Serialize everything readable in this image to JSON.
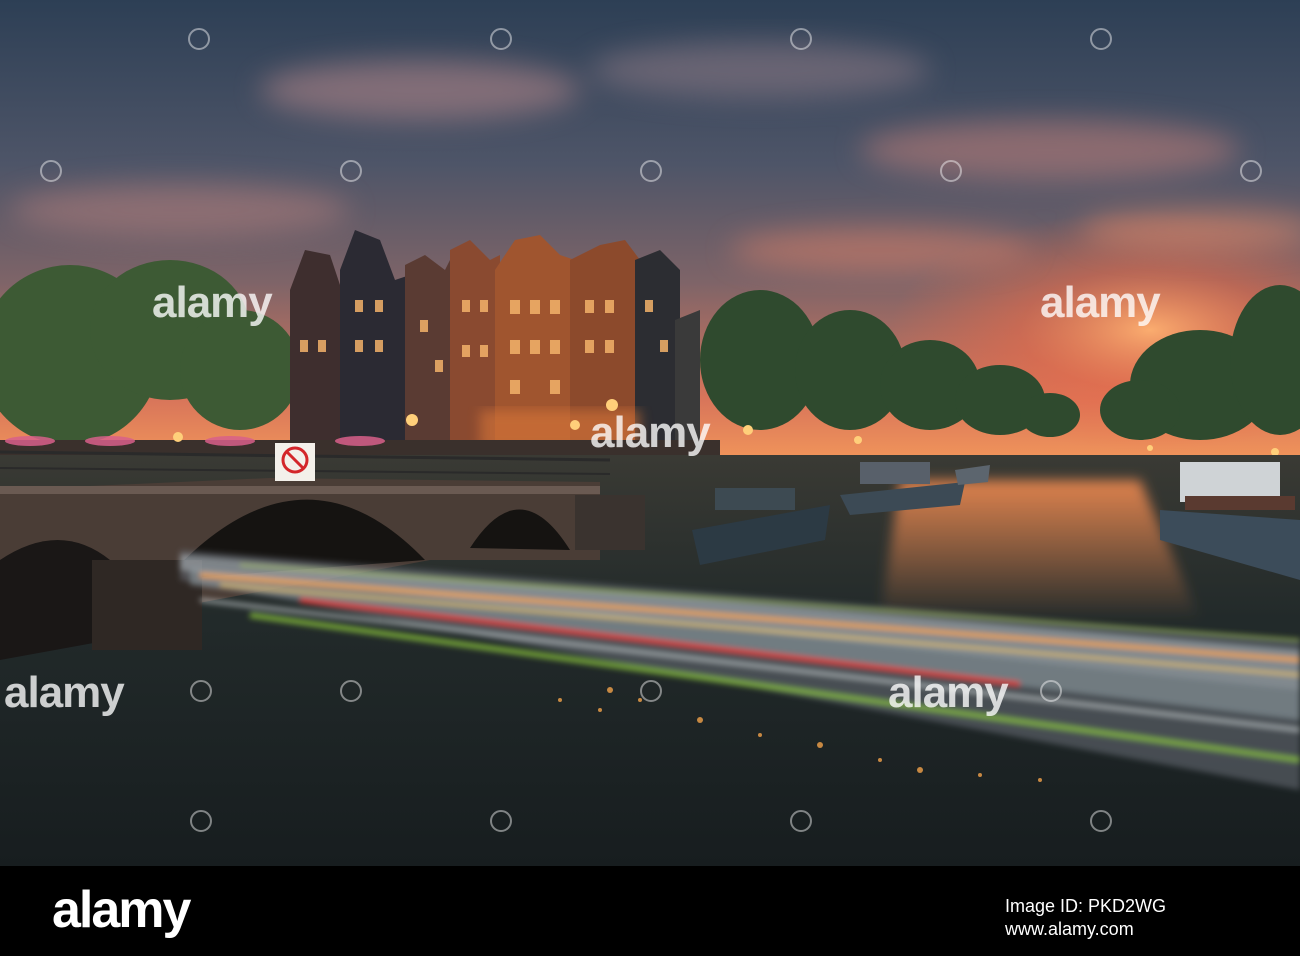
{
  "watermark": {
    "brand": "alamy"
  },
  "footer": {
    "brand": "alamy",
    "image_id": "Image ID: PKD2WG",
    "url": "www.alamy.com"
  },
  "scene": {
    "subject": "canal-bridge-at-sunset",
    "colors": {
      "sky_top": "#2f4257",
      "sky_mid": "#5a5f70",
      "sunset_glow": "#f0714a",
      "water": "#1c2326",
      "light_trail_red": "#e8302a",
      "light_trail_orange": "#f4a34a",
      "light_trail_green": "#8cc63e"
    }
  }
}
